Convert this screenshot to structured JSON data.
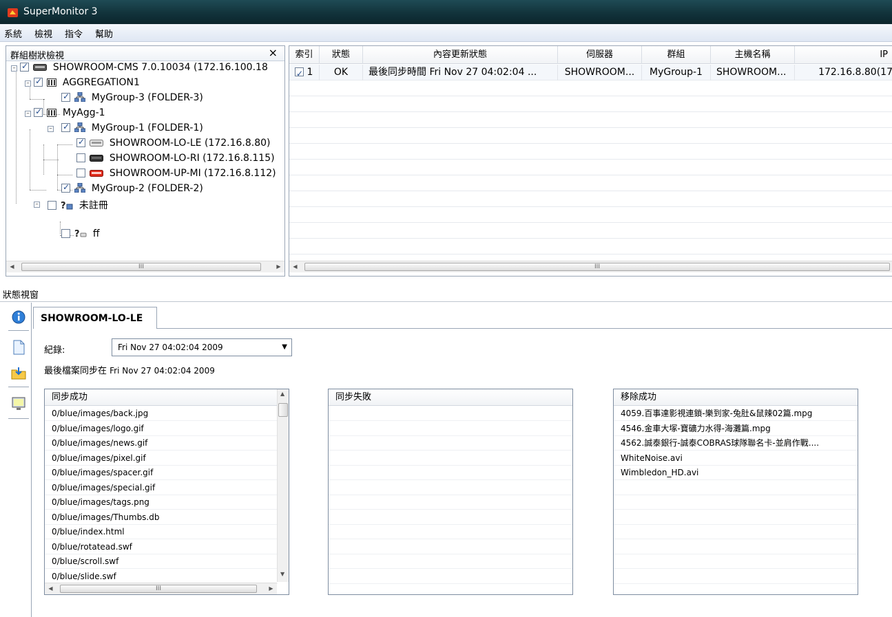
{
  "app": {
    "title": "SuperMonitor 3"
  },
  "menu": [
    "系統",
    "檢視",
    "指令",
    "幫助"
  ],
  "tree": {
    "header": "群組樹狀檢視",
    "close": "×",
    "nodes": [
      {
        "label": "SHOWROOM-CMS  7.0.10034  (172.16.100.18",
        "checked": true
      },
      {
        "label": "AGGREGATION1",
        "checked": true
      },
      {
        "label": "MyGroup-3  (FOLDER-3)",
        "checked": true
      },
      {
        "label": "MyAgg-1",
        "checked": true
      },
      {
        "label": "MyGroup-1  (FOLDER-1)",
        "checked": true
      },
      {
        "label": "SHOWROOM-LO-LE  (172.16.8.80)",
        "checked": true
      },
      {
        "label": "SHOWROOM-LO-RI  (172.16.8.115)",
        "checked": false
      },
      {
        "label": "SHOWROOM-UP-MI  (172.16.8.112)",
        "checked": false
      },
      {
        "label": "MyGroup-2  (FOLDER-2)",
        "checked": true
      },
      {
        "label": "未註冊",
        "checked": false
      },
      {
        "label": "ff",
        "checked": false
      }
    ],
    "scroll_grip": "III"
  },
  "grid": {
    "columns": [
      "索引",
      "狀態",
      "內容更新狀態",
      "伺服器",
      "群組",
      "主機名稱",
      "IP"
    ],
    "rows": [
      {
        "index": "1",
        "status": "OK",
        "update": "最後同步時間 Fri Nov 27 04:02:04 ...",
        "server": "SHOWROOM...",
        "group": "MyGroup-1",
        "host": "SHOWROOM...",
        "ip": "172.16.8.80(17"
      }
    ],
    "scroll_grip": "III"
  },
  "status": {
    "title": "狀態視窗",
    "tab": "SHOWROOM-LO-LE",
    "record_label": "紀錄:",
    "record_value": "Fri Nov 27 04:02:04 2009",
    "sync_prefix": "最後檔案同步在",
    "sync_time": "Fri Nov 27 04:02:04 2009",
    "lists": {
      "success": {
        "header": "同步成功",
        "items": [
          "0/blue/images/back.jpg",
          "0/blue/images/logo.gif",
          "0/blue/images/news.gif",
          "0/blue/images/pixel.gif",
          "0/blue/images/spacer.gif",
          "0/blue/images/special.gif",
          "0/blue/images/tags.png",
          "0/blue/images/Thumbs.db",
          "0/blue/index.html",
          "0/blue/rotatead.swf",
          "0/blue/scroll.swf",
          "0/blue/slide.swf"
        ],
        "scroll_grip": "III"
      },
      "failed": {
        "header": "同步失敗",
        "items": []
      },
      "removed": {
        "header": "移除成功",
        "items": [
          "4059.百事達影視連鎖-樂到家-兔肚&鼠辣02篇.mpg",
          "4546.金車大塚-寶礦力水得-海灘篇.mpg",
          "4562.誠泰銀行-誠泰COBRAS球隊聯名卡-並肩作戰....",
          "WhiteNoise.avi",
          "Wimbledon_HD.avi"
        ]
      }
    }
  }
}
